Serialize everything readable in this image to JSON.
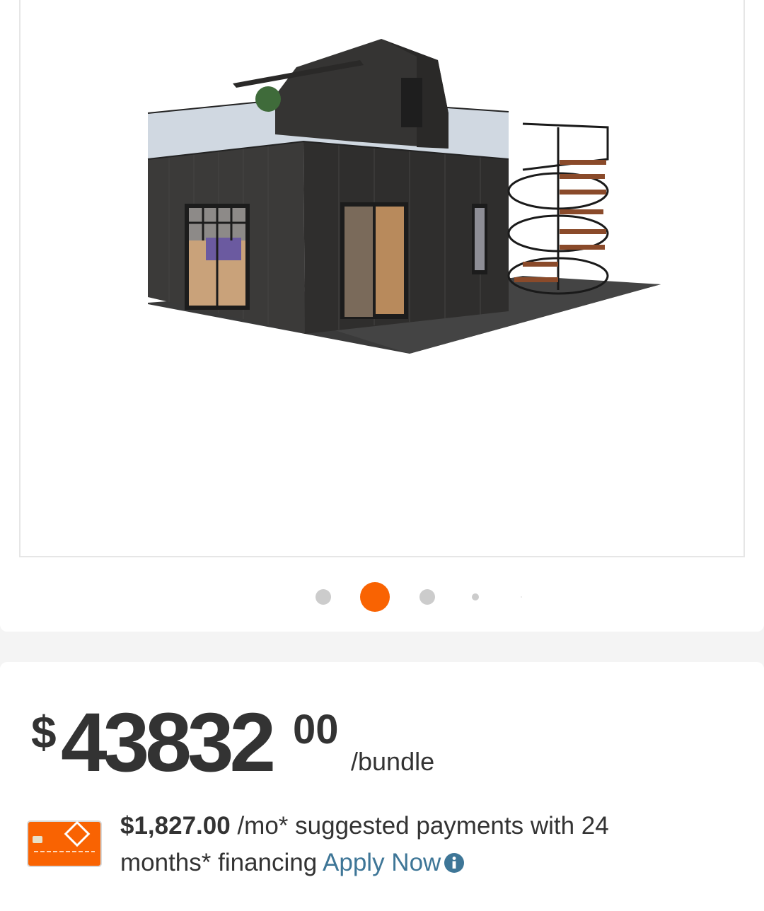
{
  "gallery": {
    "image_alt": "Two-story dark metal container home with rooftop deck and spiral staircase",
    "active_index": 1,
    "dot_count": 5
  },
  "price": {
    "currency_symbol": "$",
    "dollars": "43832",
    "cents": "00",
    "unit": "/bundle"
  },
  "financing": {
    "amount": "$1,827.00",
    "text_1": " /mo* suggested payments with 24 months* financing ",
    "apply_label": "Apply Now",
    "card_icon": "credit-card-icon",
    "info_icon": "info-icon"
  },
  "colors": {
    "accent": "#f96302",
    "link": "#3e7697",
    "text": "#333333",
    "dot_inactive": "#cccccc"
  }
}
